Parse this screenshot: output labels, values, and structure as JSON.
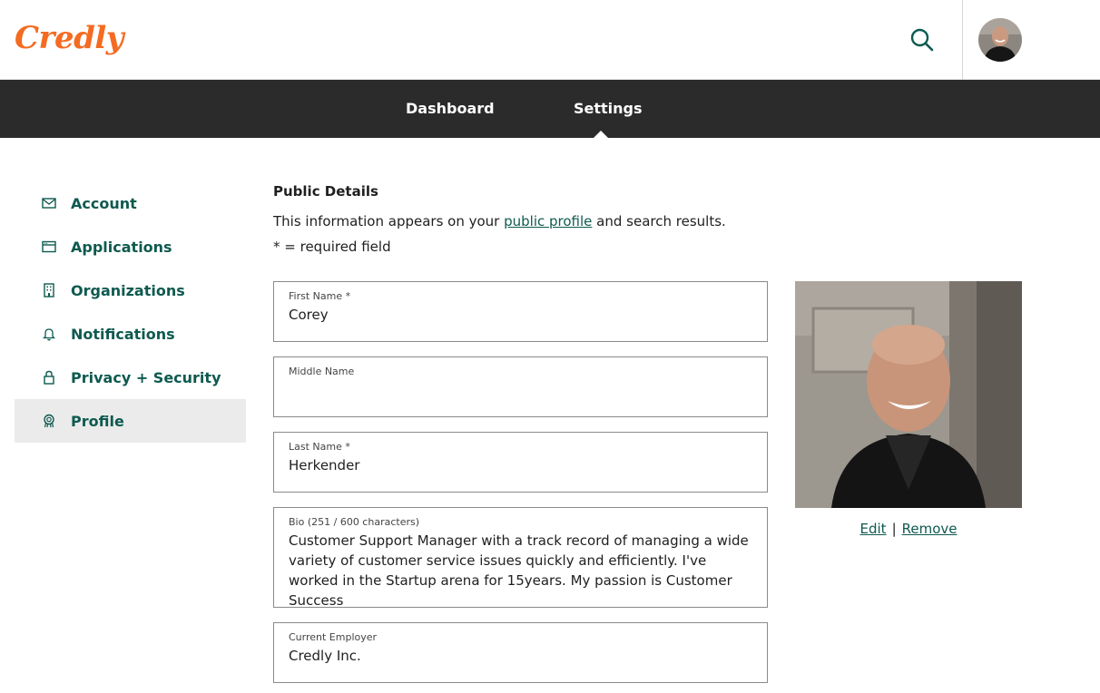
{
  "header": {
    "logo_text": "Credly",
    "search_icon": "search-icon",
    "avatar_alt": "user-avatar"
  },
  "nav": {
    "tabs": [
      {
        "label": "Dashboard",
        "active": false
      },
      {
        "label": "Settings",
        "active": true
      }
    ]
  },
  "sidebar": {
    "items": [
      {
        "label": "Account",
        "icon": "envelope-icon",
        "active": false
      },
      {
        "label": "Applications",
        "icon": "window-icon",
        "active": false
      },
      {
        "label": "Organizations",
        "icon": "building-icon",
        "active": false
      },
      {
        "label": "Notifications",
        "icon": "bell-icon",
        "active": false
      },
      {
        "label": "Privacy + Security",
        "icon": "lock-icon",
        "active": false
      },
      {
        "label": "Profile",
        "icon": "badge-icon",
        "active": true
      }
    ]
  },
  "main": {
    "section_title": "Public Details",
    "intro_before": "This information appears on your ",
    "intro_link": "public profile",
    "intro_after": " and search results.",
    "required_note": "* = required field",
    "fields": {
      "first_name": {
        "label": "First Name *",
        "value": "Corey"
      },
      "middle_name": {
        "label": "Middle Name",
        "value": ""
      },
      "last_name": {
        "label": "Last Name *",
        "value": "Herkender"
      },
      "bio": {
        "label": "Bio (251 / 600 characters)",
        "value": "Customer Support Manager with a track record of managing a wide variety of customer service issues quickly and efficiently. I've worked in the Startup arena for 15years. My passion is Customer Success"
      },
      "employer": {
        "label": "Current Employer",
        "value": "Credly Inc."
      }
    },
    "photo": {
      "edit_label": "Edit",
      "separator": "|",
      "remove_label": "Remove"
    }
  },
  "colors": {
    "brand_orange": "#f46b21",
    "accent_green": "#0e5a4f",
    "navbar_bg": "#2b2b2b",
    "active_sidebar_bg": "#ebebeb"
  }
}
